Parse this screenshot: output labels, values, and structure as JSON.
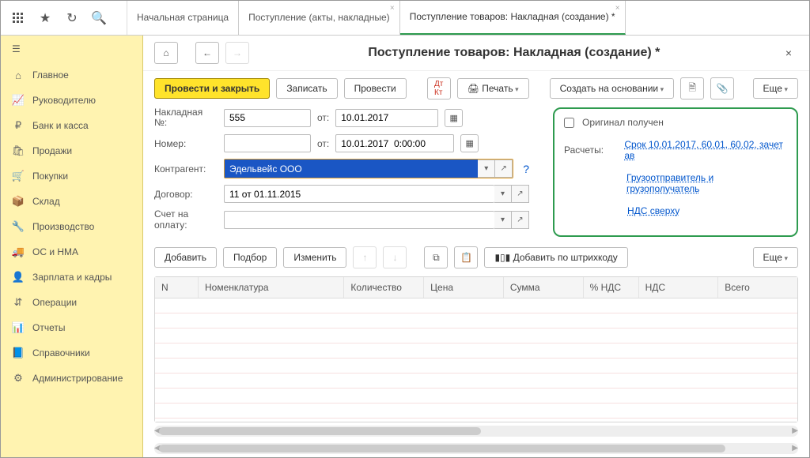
{
  "tabs": [
    {
      "label": "Начальная страница",
      "closable": false
    },
    {
      "label": "Поступление (акты, накладные)",
      "closable": true
    },
    {
      "label": "Поступление товаров: Накладная (создание) *",
      "closable": true,
      "active": true
    }
  ],
  "sidebar": {
    "items": [
      {
        "icon": "home-icon",
        "glyph": "⌂",
        "label": "Главное"
      },
      {
        "icon": "chart-icon",
        "glyph": "📈",
        "label": "Руководителю"
      },
      {
        "icon": "money-icon",
        "glyph": "₽",
        "label": "Банк и касса"
      },
      {
        "icon": "sales-icon",
        "glyph": "🛍",
        "label": "Продажи"
      },
      {
        "icon": "cart-icon",
        "glyph": "🛒",
        "label": "Покупки"
      },
      {
        "icon": "box-icon",
        "glyph": "📦",
        "label": "Склад"
      },
      {
        "icon": "production-icon",
        "glyph": "🔧",
        "label": "Производство"
      },
      {
        "icon": "assets-icon",
        "glyph": "🚚",
        "label": "ОС и НМА"
      },
      {
        "icon": "person-icon",
        "glyph": "👤",
        "label": "Зарплата и кадры"
      },
      {
        "icon": "operations-icon",
        "glyph": "⇵",
        "label": "Операции"
      },
      {
        "icon": "reports-icon",
        "glyph": "📊",
        "label": "Отчеты"
      },
      {
        "icon": "reference-icon",
        "glyph": "📘",
        "label": "Справочники"
      },
      {
        "icon": "settings-icon",
        "glyph": "⚙",
        "label": "Администрирование"
      }
    ]
  },
  "page": {
    "title": "Поступление товаров: Накладная (создание) *"
  },
  "actions": {
    "post_close": "Провести и закрыть",
    "save": "Записать",
    "post": "Провести",
    "print": "Печать",
    "create_based": "Создать на основании",
    "more": "Еще"
  },
  "form": {
    "invoice_no_label": "Накладная №:",
    "invoice_no_value": "555",
    "from_label": "от:",
    "invoice_date": "10.01.2017",
    "number_label": "Номер:",
    "number_value": "",
    "number_date": "10.01.2017  0:00:00",
    "counterparty_label": "Контрагент:",
    "counterparty_value": "Эдельвейс ООО",
    "contract_label": "Договор:",
    "contract_value": "11 от 01.11.2015",
    "payment_account_label": "Счет на оплату:",
    "payment_account_value": ""
  },
  "right": {
    "original_received": "Оригинал получен",
    "calculations_label": "Расчеты:",
    "calculations_link": "Срок 10.01.2017, 60.01, 60.02, зачет ав",
    "shipper_link": "Грузоотправитель и грузополучатель",
    "vat_link": "НДС сверху"
  },
  "table_toolbar": {
    "add": "Добавить",
    "select": "Подбор",
    "edit": "Изменить",
    "add_barcode": "Добавить по штрихкоду",
    "more": "Еще"
  },
  "grid": {
    "columns": [
      "N",
      "Номенклатура",
      "Количество",
      "Цена",
      "Сумма",
      "% НДС",
      "НДС",
      "Всего"
    ]
  }
}
